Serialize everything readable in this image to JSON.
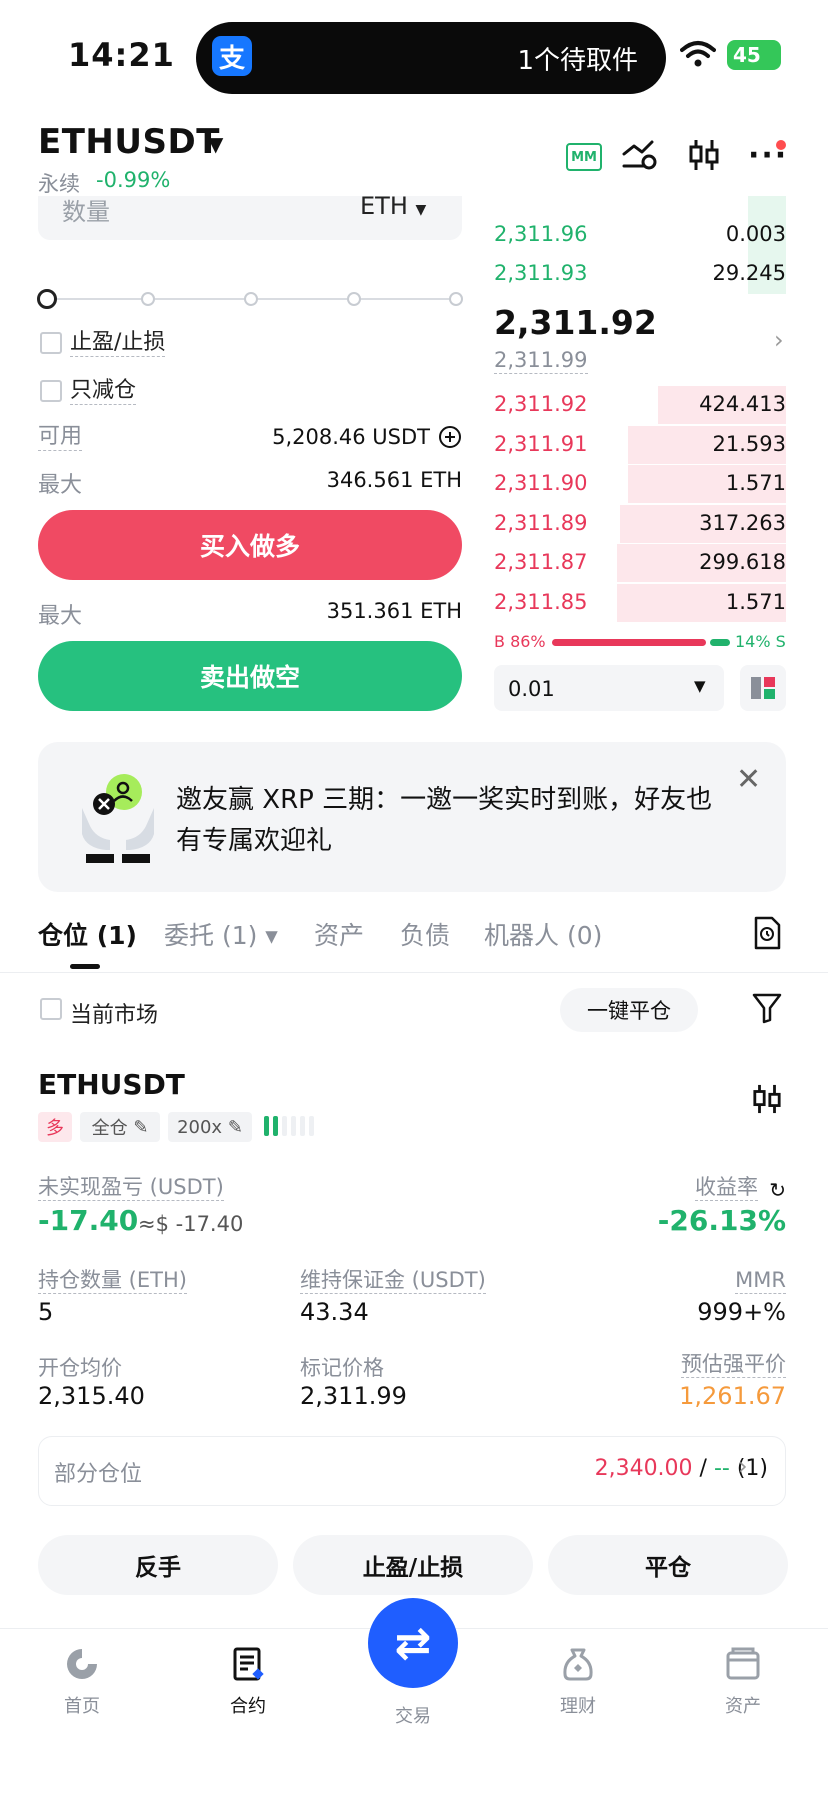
{
  "status_bar": {
    "time": "14:21",
    "island_text": "1个待取件",
    "battery": "45"
  },
  "header": {
    "symbol": "ETHUSDT",
    "contract_type": "永续",
    "change": "-0.99%",
    "mm_label": "MM"
  },
  "form": {
    "qty_placeholder": "数量",
    "qty_unit": "ETH",
    "tp_sl_label": "止盈/止损",
    "reduce_only_label": "只减仓",
    "available_label": "可用",
    "available_value": "5,208.46 USDT",
    "max_label_buy": "最大",
    "max_value_buy": "346.561 ETH",
    "buy_label": "买入做多",
    "max_label_sell": "最大",
    "max_value_sell": "351.361 ETH",
    "sell_label": "卖出做空"
  },
  "orderbook": {
    "asks": [
      {
        "price": "2,311.96",
        "qty": "0.003"
      },
      {
        "price": "2,311.93",
        "qty": "29.245"
      }
    ],
    "last_price": "2,311.92",
    "mark_price": "2,311.99",
    "bids": [
      {
        "price": "2,311.92",
        "qty": "424.413",
        "depth": 0.44
      },
      {
        "price": "2,311.91",
        "qty": "21.593",
        "depth": 0.54
      },
      {
        "price": "2,311.90",
        "qty": "1.571",
        "depth": 0.54
      },
      {
        "price": "2,311.89",
        "qty": "317.263",
        "depth": 0.57
      },
      {
        "price": "2,311.87",
        "qty": "299.618",
        "depth": 0.58
      },
      {
        "price": "2,311.85",
        "qty": "1.571",
        "depth": 0.58
      }
    ],
    "buy_ratio": "B 86%",
    "sell_ratio": "14% S",
    "depth_step": "0.01"
  },
  "banner": {
    "text": "邀友赢 XRP 三期：一邀一奖实时到账，好友也有专属欢迎礼"
  },
  "tabs": [
    {
      "label": "仓位 (1)"
    },
    {
      "label": "委托 (1) ▾"
    },
    {
      "label": "资产"
    },
    {
      "label": "负债"
    },
    {
      "label": "机器人 (0)"
    }
  ],
  "positions_toolbar": {
    "current_market_label": "当前市场",
    "close_all_label": "一键平仓"
  },
  "position": {
    "symbol": "ETHUSDT",
    "side_tag": "多",
    "margin_tag": "全仓",
    "leverage_tag": "200x",
    "unrealized_pnl_label": "未实现盈亏 (USDT)",
    "unrealized_pnl": "-17.40",
    "unrealized_pnl_usd": "≈$ -17.40",
    "roi_label": "收益率",
    "roi": "-26.13%",
    "size_label": "持仓数量 (ETH)",
    "size": "5",
    "maint_margin_label": "维持保证金 (USDT)",
    "maint_margin": "43.34",
    "mmr_label": "MMR",
    "mmr": "999+%",
    "entry_label": "开仓均价",
    "entry": "2,315.40",
    "mark_label": "标记价格",
    "mark": "2,311.99",
    "liq_label": "预估强平价",
    "liq": "1,261.67",
    "partial_label": "部分仓位",
    "partial_price": "2,340.00",
    "partial_rest": " / ",
    "partial_dash": "--",
    "partial_count": " (1)"
  },
  "actions": {
    "reverse": "反手",
    "tp_sl": "止盈/止损",
    "close": "平仓"
  },
  "nav": {
    "home": "首页",
    "contract": "合约",
    "trade": "交易",
    "finance": "理财",
    "assets": "资产"
  },
  "colors": {
    "green": "#20b26c",
    "red": "#e8385a",
    "orange": "#f59a3c",
    "blue": "#1f5eff"
  }
}
